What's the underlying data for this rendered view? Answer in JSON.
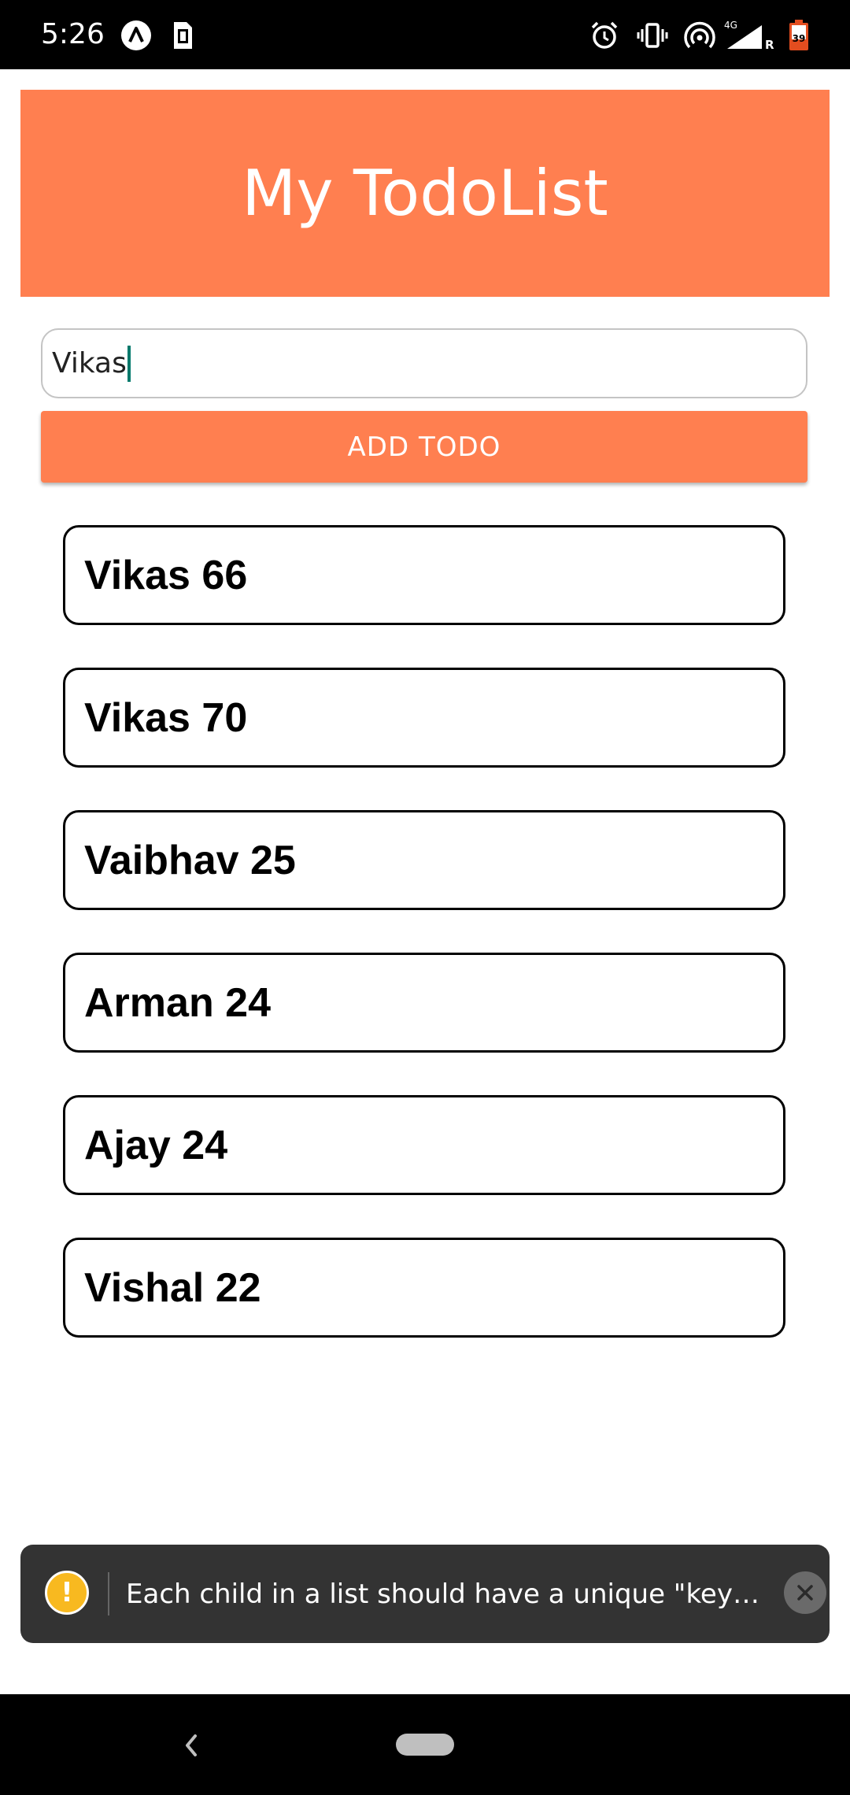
{
  "status_bar": {
    "time": "5:26",
    "icons": [
      "app-a-icon",
      "sim-card-icon",
      "alarm-icon",
      "vibrate-icon",
      "hotspot-icon",
      "signal-4g-icon",
      "battery-icon"
    ],
    "network_label": "4G",
    "roaming_label": "R",
    "battery_level": "39"
  },
  "header": {
    "title": "My TodoList",
    "background": "#ff7f50"
  },
  "todo_input": {
    "value": "Vikas"
  },
  "add_button": {
    "label": "ADD TODO",
    "background": "#ff7f50"
  },
  "todos": [
    {
      "text": "Vikas 66"
    },
    {
      "text": "Vikas 70"
    },
    {
      "text": "Vaibhav 25"
    },
    {
      "text": "Arman 24"
    },
    {
      "text": "Ajay 24"
    },
    {
      "text": "Vishal 22"
    }
  ],
  "warning_toast": {
    "icon": "warning-icon",
    "icon_glyph": "!",
    "message": "Each child in a list should have a unique \"key\" p...",
    "close_icon": "close-icon",
    "accent": "#f8b920"
  },
  "nav_bar": {
    "back_icon": "back-icon",
    "home_icon": "home-pill-icon"
  }
}
